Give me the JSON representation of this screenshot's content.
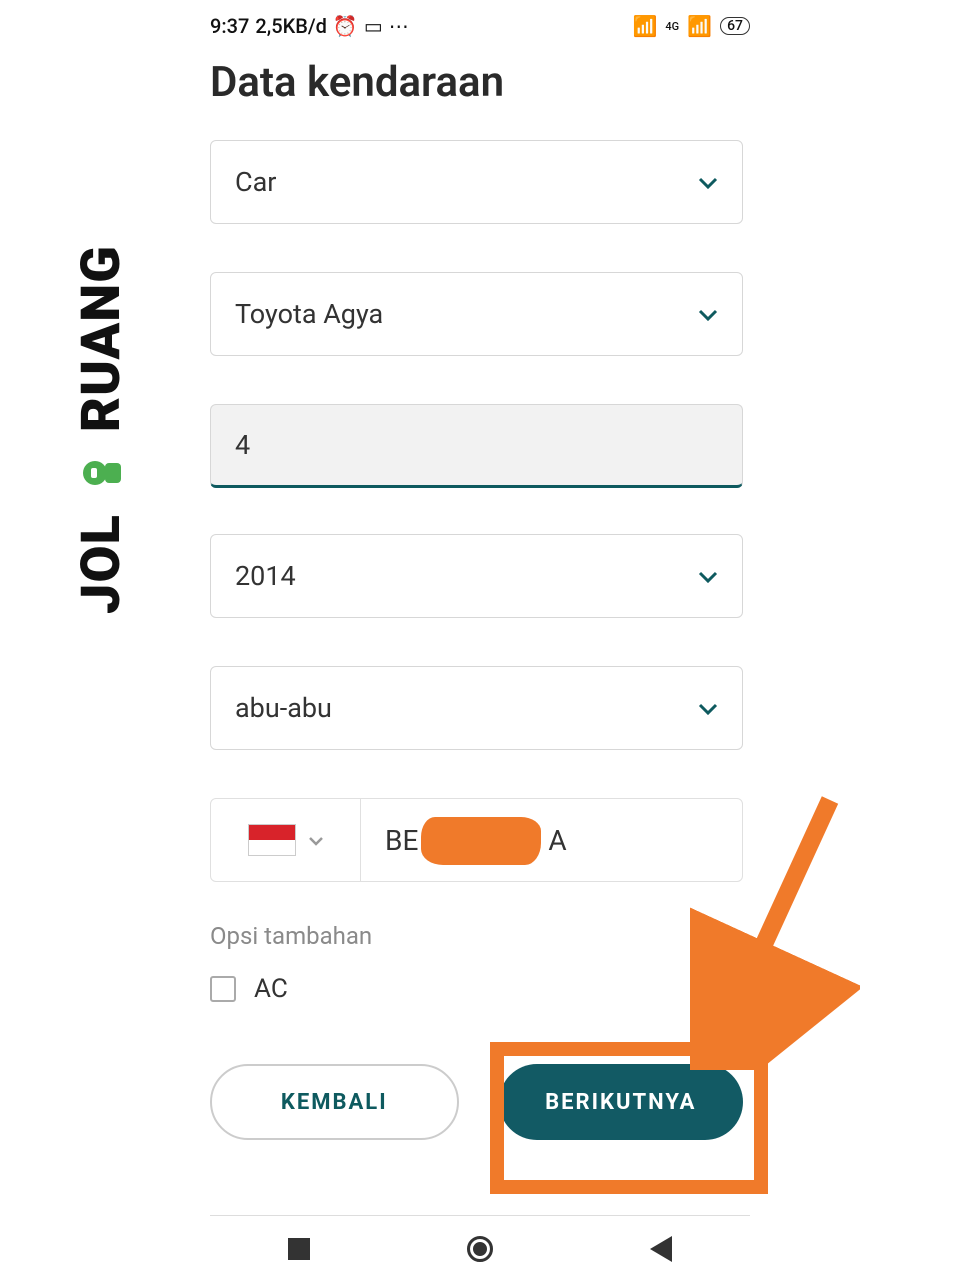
{
  "status": {
    "time": "9:37",
    "data_rate": "2,5KB/d",
    "network_label": "4G",
    "battery": "67"
  },
  "page": {
    "title": "Data kendaraan"
  },
  "form": {
    "vehicle_type": "Car",
    "vehicle_model": "Toyota Agya",
    "seats": "4",
    "year": "2014",
    "color": "abu-abu",
    "plate_prefix": "BE",
    "plate_suffix": "A"
  },
  "options": {
    "section_label": "Opsi tambahan",
    "ac_label": "AC"
  },
  "buttons": {
    "back": "KEMBALI",
    "next": "BERIKUTNYA"
  },
  "watermark": {
    "text_before": "RUANG",
    "text_after": "JOL"
  }
}
